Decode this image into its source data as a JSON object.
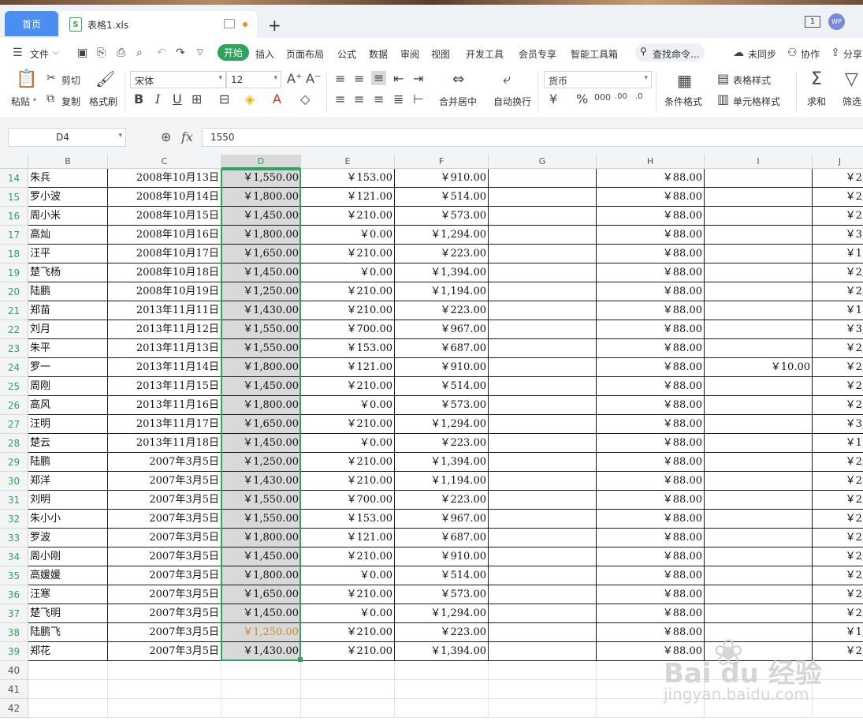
{
  "window": {
    "home_tab": "首页",
    "file_tab": "表格1.xls",
    "new_tab_glyph": "+",
    "badge": "1",
    "avatar_text": "WP"
  },
  "menu": {
    "file": "文件",
    "items": [
      "开始",
      "插入",
      "页面布局",
      "公式",
      "数据",
      "审阅",
      "视图",
      "开发工具",
      "会员专享",
      "智能工具箱"
    ],
    "search_placeholder": "查找命令...",
    "sync": "未同步",
    "collab": "协作",
    "share": "分享"
  },
  "ribbon": {
    "paste": "粘贴",
    "cut": "剪切",
    "copy": "复制",
    "format_painter": "格式刷",
    "font_name": "宋体",
    "font_size": "12",
    "merge_center": "合并居中",
    "wrap_text": "自动换行",
    "number_format": "货币",
    "conditional_format": "条件格式",
    "table_style": "表格样式",
    "cell_style": "单元格样式",
    "sum": "求和",
    "filter": "筛选"
  },
  "formula_bar": {
    "name_box": "D4",
    "fx": "fx",
    "value": "1550"
  },
  "grid": {
    "columns": [
      "B",
      "C",
      "D",
      "E",
      "F",
      "G",
      "H",
      "I",
      "J"
    ],
    "selected_column": "D",
    "rows": [
      {
        "n": "14",
        "name": "朱兵",
        "date": "2008年10月13日",
        "d": "￥1,550.00",
        "e": "￥153.00",
        "f": "￥910.00",
        "h": "￥88.00",
        "i": "",
        "j": "￥2,"
      },
      {
        "n": "15",
        "name": "罗小波",
        "date": "2008年10月14日",
        "d": "￥1,800.00",
        "e": "￥121.00",
        "f": "￥514.00",
        "h": "￥88.00",
        "i": "",
        "j": "￥2,"
      },
      {
        "n": "16",
        "name": "周小米",
        "date": "2008年10月15日",
        "d": "￥1,450.00",
        "e": "￥210.00",
        "f": "￥573.00",
        "h": "￥88.00",
        "i": "",
        "j": "￥2,"
      },
      {
        "n": "17",
        "name": "高灿",
        "date": "2008年10月16日",
        "d": "￥1,800.00",
        "e": "￥0.00",
        "f": "￥1,294.00",
        "h": "￥88.00",
        "i": "",
        "j": "￥3,"
      },
      {
        "n": "18",
        "name": "汪平",
        "date": "2008年10月17日",
        "d": "￥1,650.00",
        "e": "￥210.00",
        "f": "￥223.00",
        "h": "￥88.00",
        "i": "",
        "j": "￥1,"
      },
      {
        "n": "19",
        "name": "楚飞杨",
        "date": "2008年10月18日",
        "d": "￥1,450.00",
        "e": "￥0.00",
        "f": "￥1,394.00",
        "h": "￥88.00",
        "i": "",
        "j": "￥2,"
      },
      {
        "n": "20",
        "name": "陆鹏",
        "date": "2008年10月19日",
        "d": "￥1,250.00",
        "e": "￥210.00",
        "f": "￥1,194.00",
        "h": "￥88.00",
        "i": "",
        "j": "￥2,"
      },
      {
        "n": "21",
        "name": "郑苗",
        "date": "2013年11月11日",
        "d": "￥1,430.00",
        "e": "￥210.00",
        "f": "￥223.00",
        "h": "￥88.00",
        "i": "",
        "j": "￥1,"
      },
      {
        "n": "22",
        "name": "刘月",
        "date": "2013年11月12日",
        "d": "￥1,550.00",
        "e": "￥700.00",
        "f": "￥967.00",
        "h": "￥88.00",
        "i": "",
        "j": "￥3,"
      },
      {
        "n": "23",
        "name": "朱平",
        "date": "2013年11月13日",
        "d": "￥1,550.00",
        "e": "￥153.00",
        "f": "￥687.00",
        "h": "￥88.00",
        "i": "",
        "j": "￥2,"
      },
      {
        "n": "24",
        "name": "罗一",
        "date": "2013年11月14日",
        "d": "￥1,800.00",
        "e": "￥121.00",
        "f": "￥910.00",
        "h": "￥88.00",
        "i": "￥10.00",
        "j": "￥2,"
      },
      {
        "n": "25",
        "name": "周刚",
        "date": "2013年11月15日",
        "d": "￥1,450.00",
        "e": "￥210.00",
        "f": "￥514.00",
        "h": "￥88.00",
        "i": "",
        "j": "￥2,"
      },
      {
        "n": "26",
        "name": "高风",
        "date": "2013年11月16日",
        "d": "￥1,800.00",
        "e": "￥0.00",
        "f": "￥573.00",
        "h": "￥88.00",
        "i": "",
        "j": "￥2,"
      },
      {
        "n": "27",
        "name": "汪明",
        "date": "2013年11月17日",
        "d": "￥1,650.00",
        "e": "￥210.00",
        "f": "￥1,294.00",
        "h": "￥88.00",
        "i": "",
        "j": "￥3,"
      },
      {
        "n": "28",
        "name": "楚云",
        "date": "2013年11月18日",
        "d": "￥1,450.00",
        "e": "￥0.00",
        "f": "￥223.00",
        "h": "￥88.00",
        "i": "",
        "j": "￥1,"
      },
      {
        "n": "29",
        "name": "陆鹏",
        "date": "2007年3月5日",
        "d": "￥1,250.00",
        "e": "￥210.00",
        "f": "￥1,394.00",
        "h": "￥88.00",
        "i": "",
        "j": "￥2,"
      },
      {
        "n": "30",
        "name": "郑洋",
        "date": "2007年3月5日",
        "d": "￥1,430.00",
        "e": "￥210.00",
        "f": "￥1,194.00",
        "h": "￥88.00",
        "i": "",
        "j": "￥2,"
      },
      {
        "n": "31",
        "name": "刘明",
        "date": "2007年3月5日",
        "d": "￥1,550.00",
        "e": "￥700.00",
        "f": "￥223.00",
        "h": "￥88.00",
        "i": "",
        "j": "￥2,"
      },
      {
        "n": "32",
        "name": "朱小小",
        "date": "2007年3月5日",
        "d": "￥1,550.00",
        "e": "￥153.00",
        "f": "￥967.00",
        "h": "￥88.00",
        "i": "",
        "j": "￥2,"
      },
      {
        "n": "33",
        "name": "罗波",
        "date": "2007年3月5日",
        "d": "￥1,800.00",
        "e": "￥121.00",
        "f": "￥687.00",
        "h": "￥88.00",
        "i": "",
        "j": "￥2,"
      },
      {
        "n": "34",
        "name": "周小刚",
        "date": "2007年3月5日",
        "d": "￥1,450.00",
        "e": "￥210.00",
        "f": "￥910.00",
        "h": "￥88.00",
        "i": "",
        "j": "￥2,"
      },
      {
        "n": "35",
        "name": "高媛媛",
        "date": "2007年3月5日",
        "d": "￥1,800.00",
        "e": "￥0.00",
        "f": "￥514.00",
        "h": "￥88.00",
        "i": "",
        "j": "￥2,"
      },
      {
        "n": "36",
        "name": "汪寒",
        "date": "2007年3月5日",
        "d": "￥1,650.00",
        "e": "￥210.00",
        "f": "￥573.00",
        "h": "￥88.00",
        "i": "",
        "j": "￥2,"
      },
      {
        "n": "37",
        "name": "楚飞明",
        "date": "2007年3月5日",
        "d": "￥1,450.00",
        "e": "￥0.00",
        "f": "￥1,294.00",
        "h": "￥88.00",
        "i": "",
        "j": "￥2,"
      },
      {
        "n": "38",
        "name": "陆鹏飞",
        "date": "2007年3月5日",
        "d": "￥1,250.00",
        "e": "￥210.00",
        "f": "￥223.00",
        "h": "￥88.00",
        "i": "",
        "j": "￥1,"
      },
      {
        "n": "39",
        "name": "郑花",
        "date": "2007年3月5日",
        "d": "￥1,430.00",
        "e": "￥210.00",
        "f": "￥1,394.00",
        "h": "￥88.00",
        "i": "",
        "j": "￥2,"
      }
    ],
    "empty_rows": [
      "40",
      "41",
      "42"
    ]
  },
  "watermark": {
    "brand": "Bai du 经验",
    "url": "jingyan.baidu.com"
  },
  "colors": {
    "accent_green": "#2fa45c",
    "tab_blue": "#4a8ff0",
    "highlight_orange": "#c9892a"
  }
}
